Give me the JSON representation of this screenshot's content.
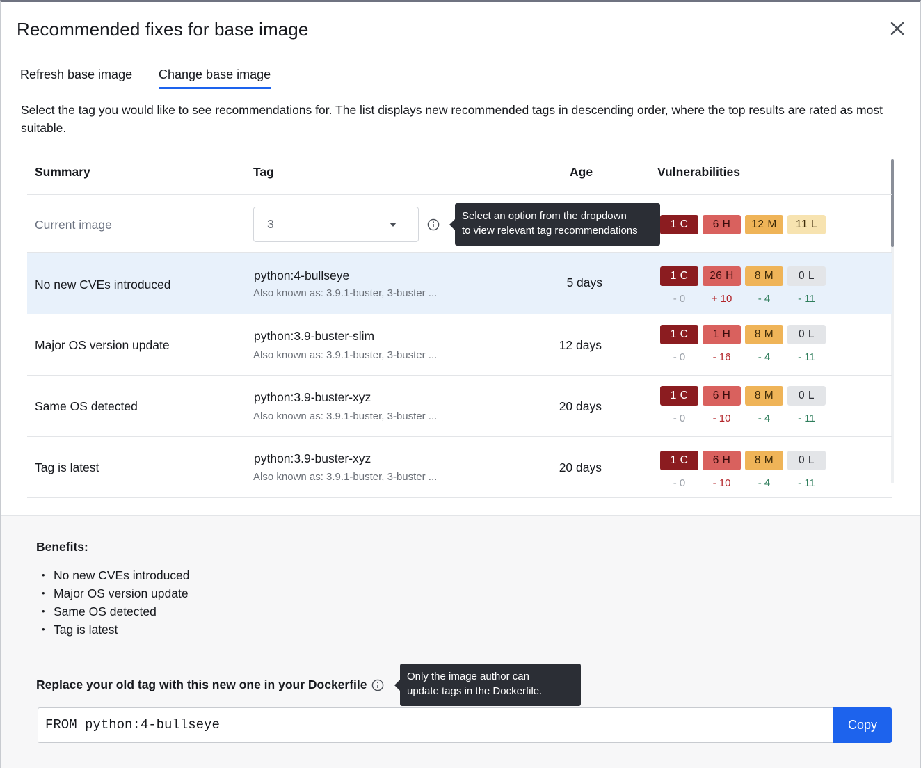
{
  "dialog": {
    "title": "Recommended fixes for base image",
    "close_icon": "close-icon"
  },
  "tabs": [
    {
      "label": "Refresh base image",
      "active": false
    },
    {
      "label": "Change base image",
      "active": true
    }
  ],
  "description": "Select the tag you would like to see recommendations for. The list displays new recommended tags in descending order, where the top results are rated as most suitable.",
  "table": {
    "headers": {
      "summary": "Summary",
      "tag": "Tag",
      "age": "Age",
      "vulnerabilities": "Vulnerabilities"
    },
    "current": {
      "summary": "Current image",
      "dropdown_value": "3",
      "tooltip": [
        "Select an option from the dropdown",
        "to view relevant tag recommendations"
      ],
      "badges": [
        "1 C",
        "6 H",
        "12 M",
        "11 L"
      ]
    },
    "rows": [
      {
        "summary": "No new CVEs introduced",
        "tag": "python:4-bullseye",
        "aka": "Also known as: 3.9.1-buster, 3-buster ...",
        "age": "5 days",
        "badges": [
          "1 C",
          "26 H",
          "8 M",
          "0 L"
        ],
        "deltas": [
          "- 0",
          "+ 10",
          "- 4",
          "- 11"
        ]
      },
      {
        "summary": "Major OS version update",
        "tag": "python:3.9-buster-slim",
        "aka": "Also known as: 3.9.1-buster, 3-buster ...",
        "age": "12 days",
        "badges": [
          "1 C",
          "1 H",
          "8 M",
          "0 L"
        ],
        "deltas": [
          "- 0",
          "- 16",
          "- 4",
          "- 11"
        ]
      },
      {
        "summary": "Same OS detected",
        "tag": "python:3.9-buster-xyz",
        "aka": "Also known as: 3.9.1-buster, 3-buster ...",
        "age": "20 days",
        "badges": [
          "1 C",
          "6 H",
          "8 M",
          "0 L"
        ],
        "deltas": [
          "- 0",
          "- 10",
          "- 4",
          "- 11"
        ]
      },
      {
        "summary": "Tag is latest",
        "tag": "python:3.9-buster-xyz",
        "aka": "Also known as: 3.9.1-buster, 3-buster ...",
        "age": "20 days",
        "badges": [
          "1 C",
          "6 H",
          "8 M",
          "0 L"
        ],
        "deltas": [
          "- 0",
          "- 10",
          "- 4",
          "- 11"
        ]
      }
    ]
  },
  "footer": {
    "benefits_title": "Benefits:",
    "benefits": [
      "No new CVEs introduced",
      "Major OS version update",
      "Same OS detected",
      "Tag is latest"
    ],
    "replace_label": "Replace your old tag with this new one in your Dockerfile",
    "tooltip": [
      "Only the image author can",
      "update tags in the Dockerfile."
    ],
    "code": "FROM python:4-bullseye",
    "copy_label": "Copy"
  },
  "colors": {
    "accent": "#1d63ed",
    "critical": "#8b1c20",
    "high": "#d9615e",
    "medium": "#efb458",
    "low": "#f7e3b0",
    "neutral": "#e3e5e8",
    "selected_row": "#e8f1fb"
  }
}
